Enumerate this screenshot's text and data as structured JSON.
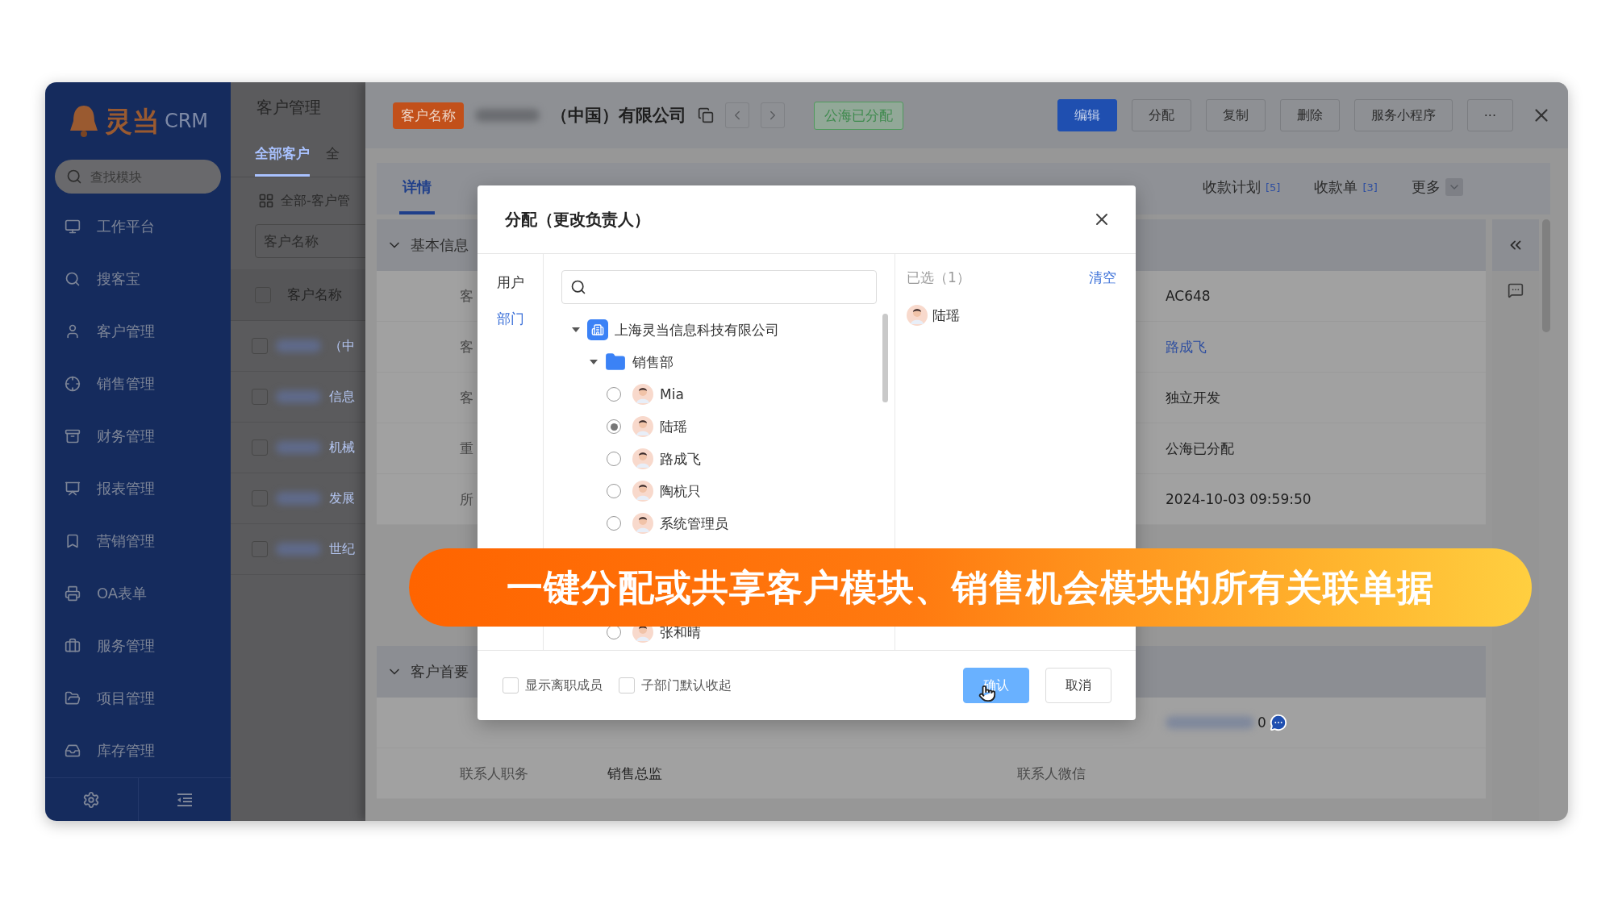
{
  "sidebar": {
    "logo_text": "灵当",
    "logo_suffix": "CRM",
    "search_placeholder": "查找模块",
    "items": [
      "工作平台",
      "搜客宝",
      "客户管理",
      "销售管理",
      "财务管理",
      "报表管理",
      "营销管理",
      "OA表单",
      "服务管理",
      "项目管理",
      "库存管理"
    ]
  },
  "list_page": {
    "title": "客户管理",
    "tabs": [
      {
        "label": "全部客户",
        "selected": true
      },
      {
        "label": "全",
        "selected": false
      }
    ],
    "view": "全部-客户管",
    "filter_placeholder": "客户名称",
    "column": "客户名称",
    "all_checked": false,
    "rows": [
      {
        "text": "（中",
        "checked": false
      },
      {
        "text": "信息",
        "checked": false
      },
      {
        "text": "机械",
        "checked": false
      },
      {
        "text": "发展",
        "checked": false
      },
      {
        "text": "世纪",
        "checked": false
      }
    ]
  },
  "detail": {
    "tag": "客户名称",
    "title": "（中国）有限公司",
    "status": "公海已分配",
    "actions": [
      {
        "label": "编辑",
        "primary": true
      },
      {
        "label": "分配",
        "primary": false
      },
      {
        "label": "复制",
        "primary": false
      },
      {
        "label": "删除",
        "primary": false
      },
      {
        "label": "服务小程序",
        "primary": false
      },
      {
        "label": "···",
        "primary": false
      }
    ],
    "tabs": [
      {
        "label": "详情",
        "kind": "tab",
        "selected": true
      },
      {
        "label": "收款计划",
        "count": "[5]",
        "kind": "tab",
        "selected": false
      },
      {
        "label": "收款单",
        "count": "[3]",
        "kind": "tab",
        "selected": false
      },
      {
        "label": "更多",
        "kind": "dropdown",
        "selected": false
      }
    ],
    "sections": [
      {
        "title": "基本信息",
        "rows": [
          {
            "kind": "text",
            "label": "客",
            "value2": "AC648",
            "link": false
          },
          {
            "kind": "text",
            "label": "客",
            "value2": "路成飞",
            "link": true
          },
          {
            "kind": "text",
            "label": "客",
            "value2": "独立开发",
            "link": false
          },
          {
            "kind": "text",
            "label": "重",
            "value2": "公海已分配",
            "link": false
          },
          {
            "kind": "text",
            "label": "所",
            "value2": "2024-10-03 09:59:50",
            "link": false
          }
        ]
      },
      {
        "title": "客户首要",
        "rows": [
          {
            "kind": "phone",
            "value2": "0",
            "link": false
          },
          {
            "kind": "text",
            "label": "联系人职务",
            "value": "销售总监",
            "label2": "联系人微信",
            "link": false
          }
        ]
      }
    ]
  },
  "modal": {
    "title": "分配（更改负责人）",
    "modes": [
      {
        "label": "用户",
        "selected": false
      },
      {
        "label": "部门",
        "selected": true
      }
    ],
    "tree": [
      {
        "label": "上海灵当信息科技有限公司",
        "kind": "company",
        "expanded": true,
        "children": [
          {
            "label": "销售部",
            "kind": "department",
            "expanded": true,
            "children": [
              {
                "label": "Mia",
                "kind": "member",
                "selected": false
              },
              {
                "label": "陆瑶",
                "kind": "member",
                "selected": true
              },
              {
                "label": "路成飞",
                "kind": "member",
                "selected": false
              },
              {
                "label": "陶杭只",
                "kind": "member",
                "selected": false
              },
              {
                "label": "系统管理员",
                "kind": "member",
                "selected": false
              },
              {
                "label": "张和晴",
                "kind": "member",
                "selected": false
              }
            ]
          }
        ]
      }
    ],
    "selected_title": "已选（1）",
    "clear": "清空",
    "selected_members": [
      "陆瑶"
    ],
    "options": [
      {
        "label": "显示离职成员",
        "checked": false
      },
      {
        "label": "子部门默认收起",
        "checked": false
      }
    ],
    "buttons": [
      {
        "label": "确认",
        "primary": true
      },
      {
        "label": "取消",
        "primary": false
      }
    ]
  },
  "banner": {
    "text": "一键分配或共享客户模块、销售机会模块的所有关联单据"
  }
}
